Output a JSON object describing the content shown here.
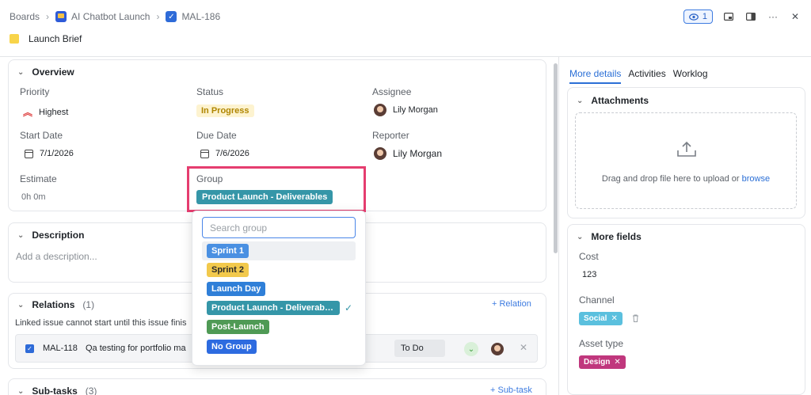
{
  "breadcrumb": {
    "boards": "Boards",
    "project": "AI Chatbot Launch",
    "issue": "MAL-186"
  },
  "title": "Launch Brief",
  "header": {
    "watch_count": "1"
  },
  "overview": {
    "heading": "Overview",
    "priority_label": "Priority",
    "priority_value": "Highest",
    "status_label": "Status",
    "status_value": "In Progress",
    "assignee_label": "Assignee",
    "assignee_value": "Lily Morgan",
    "start_label": "Start Date",
    "start_value": "7/1/2026",
    "due_label": "Due Date",
    "due_value": "7/6/2026",
    "reporter_label": "Reporter",
    "reporter_value": "Lily Morgan",
    "estimate_label": "Estimate",
    "estimate_value": "0h 0m",
    "group_label": "Group",
    "group_value": "Product Launch - Deliverables"
  },
  "group_dropdown": {
    "placeholder": "Search group",
    "options": [
      {
        "label": "Sprint 1",
        "color": "#4a90e2"
      },
      {
        "label": "Sprint 2",
        "color": "#f2c94c"
      },
      {
        "label": "Launch Day",
        "color": "#2f7fd8"
      },
      {
        "label": "Product Launch - Deliverables",
        "color": "#3596a8"
      },
      {
        "label": "Post-Launch",
        "color": "#4f9a55"
      },
      {
        "label": "No Group",
        "color": "#2d6be0"
      }
    ]
  },
  "description": {
    "heading": "Description",
    "placeholder": "Add a description..."
  },
  "relations": {
    "heading": "Relations",
    "count": "(1)",
    "add_label": "+ Relation",
    "note": "Linked issue cannot start until this issue finis",
    "row": {
      "key": "MAL-118",
      "summary": "Qa testing for portfolio ma",
      "status": "To Do"
    }
  },
  "subtasks": {
    "heading": "Sub-tasks",
    "count": "(3)",
    "add_label": "+ Sub-task"
  },
  "right_panel": {
    "tabs": [
      "More details",
      "Activities",
      "Worklog"
    ],
    "attachments_heading": "Attachments",
    "drop_text": "Drag and drop file here to upload or ",
    "browse_label": "browse",
    "more_fields_heading": "More fields",
    "cost_label": "Cost",
    "cost_value": "123",
    "channel_label": "Channel",
    "channel_value": "Social",
    "asset_label": "Asset type",
    "asset_value": "Design"
  },
  "colors": {
    "accent": "#2b6fd6",
    "highlight": "#e53d6f",
    "social": "#5bc0de",
    "design": "#c0377d"
  }
}
